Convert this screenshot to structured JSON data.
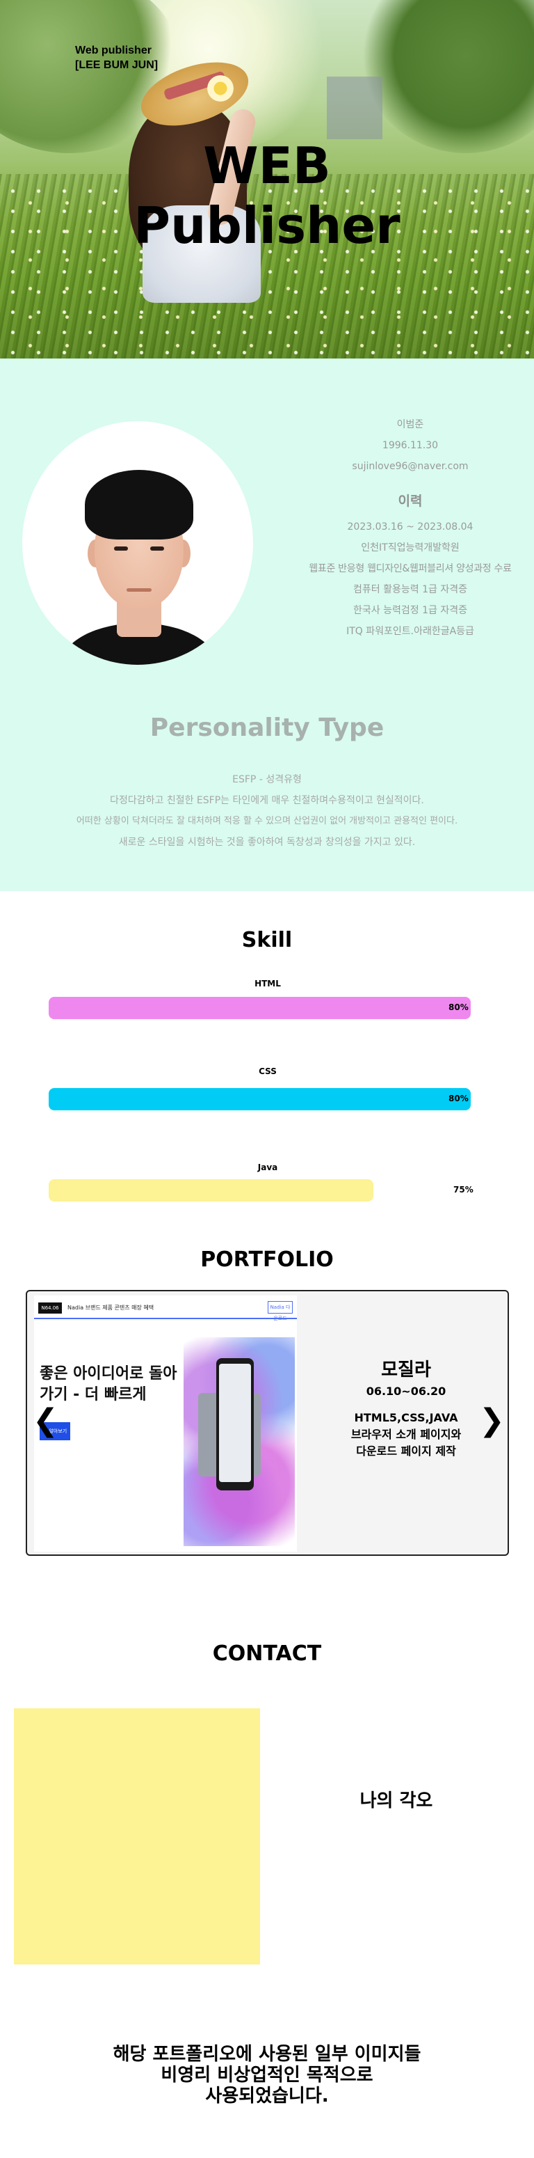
{
  "hero": {
    "tagline": "Web publisher",
    "name": "[LEE BUM JUN]",
    "title_line1": "WEB",
    "title_line2": "Publisher"
  },
  "about": {
    "name": "이범준",
    "birth": "1996.11.30",
    "email": "sujinlove96@naver.com",
    "career_title": "이력",
    "career": [
      "2023.03.16 ~ 2023.08.04",
      "인천IT직업능력개발학원",
      "웹표준 반응형 웹디자인&웹퍼블리셔 양성과정 수료",
      "컴퓨터 활용능력 1급 자격증",
      "한국사 능력검정 1급 자격증",
      "ITQ 파워포인트.아래한글A등급"
    ],
    "personality_title": "Personality Type",
    "personality": [
      "ESFP - 성격유형",
      "다정다감하고 친절한 ESFP는 타인에게 매우 친절하며수용적이고 현실적이다.",
      "어떠한 상황이 닥쳐더라도 잘 대처하며 적응 할 수 있으며 산업권이 없어 개방적이고 관용적인 편이다.",
      "새로운 스타일을 시험하는 것을 좋아하여 독창성과 창의성을 가지고 있다."
    ]
  },
  "skill": {
    "title": "Skill",
    "items": [
      {
        "name": "HTML",
        "percent_label": "80%",
        "level": 0.8,
        "color": "#ee88ee"
      },
      {
        "name": "CSS",
        "percent_label": "80%",
        "level": 0.8,
        "color": "#00ccf5"
      },
      {
        "name": "Java",
        "percent_label": "75%",
        "level": 0.75,
        "color": "#fdf294"
      }
    ]
  },
  "portfolio": {
    "title": "PORTFOLIO",
    "shot": {
      "logo": "N64.06",
      "menu": "Nadia 브랜드   제품   콘텐츠 매장   혜택",
      "nav_button": "Nadia 다운로드",
      "headline": "좋은 아이디어로 돌아가기 - 더 빠르게",
      "button": "더 알아보기"
    },
    "project_name": "모질라",
    "dates": "06.10~06.20",
    "details": [
      "HTML5,CSS,JAVA",
      "브라우저 소개 페이지와",
      "다운로드 페이지 제작"
    ],
    "prev_icon": "❮",
    "next_icon": "❯"
  },
  "contact": {
    "title": "CONTACT",
    "heading": "나의 각오",
    "box_color": "#fdf294"
  },
  "disclaimer": [
    "해당 포트폴리오에 사용된 일부 이미지들",
    "비영리 비상업적인 목적으로",
    "사용되었습니다."
  ]
}
